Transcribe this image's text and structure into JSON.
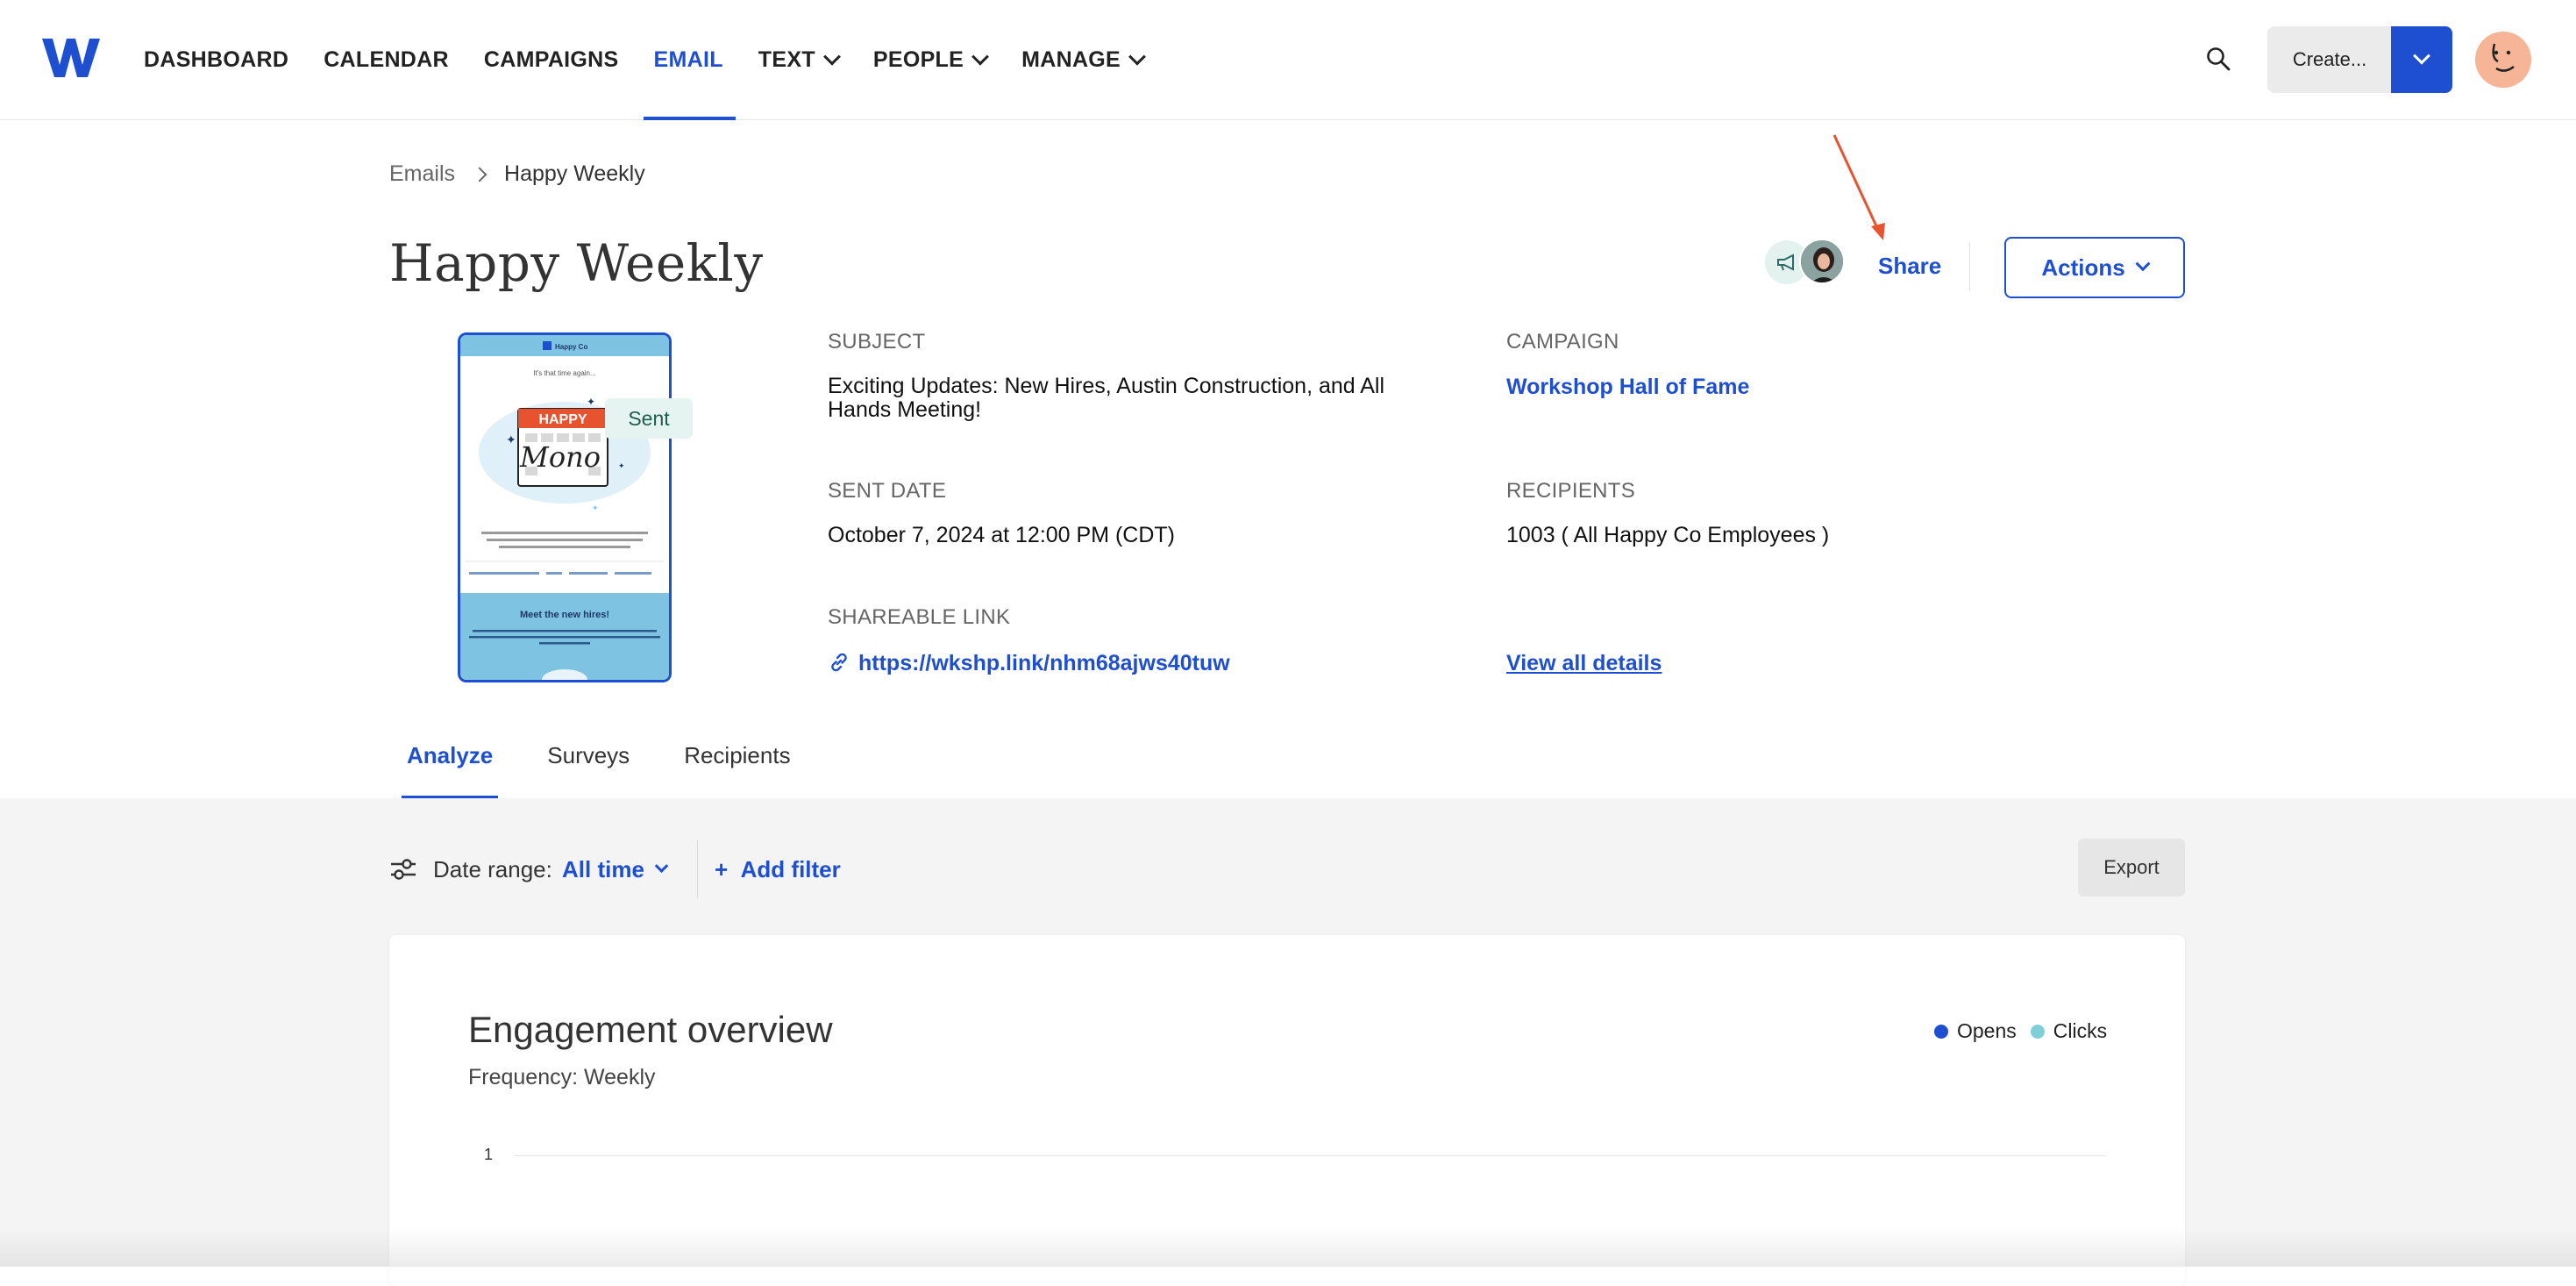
{
  "nav": {
    "items": [
      {
        "label": "DASHBOARD",
        "active": false,
        "has_dropdown": false
      },
      {
        "label": "CALENDAR",
        "active": false,
        "has_dropdown": false
      },
      {
        "label": "CAMPAIGNS",
        "active": false,
        "has_dropdown": false
      },
      {
        "label": "EMAIL",
        "active": true,
        "has_dropdown": false
      },
      {
        "label": "TEXT",
        "active": false,
        "has_dropdown": true
      },
      {
        "label": "PEOPLE",
        "active": false,
        "has_dropdown": true
      },
      {
        "label": "MANAGE",
        "active": false,
        "has_dropdown": true
      }
    ],
    "create_label": "Create..."
  },
  "breadcrumb": {
    "parent": "Emails",
    "current": "Happy Weekly"
  },
  "header": {
    "title": "Happy Weekly",
    "share_label": "Share",
    "actions_label": "Actions"
  },
  "preview": {
    "brand": "Happy Co",
    "intro": "It's that time again...",
    "happy_word": "HAPPY",
    "mono_word": "Mono",
    "sent_badge": "Sent",
    "section_heading": "Meet the new hires!"
  },
  "details": {
    "subject_label": "SUBJECT",
    "subject_value": "Exciting Updates: New Hires, Austin Construction, and All Hands Meeting!",
    "campaign_label": "CAMPAIGN",
    "campaign_value": "Workshop Hall of Fame",
    "sent_date_label": "SENT DATE",
    "sent_date_value": "October 7, 2024 at 12:00 PM (CDT)",
    "recipients_label": "RECIPIENTS",
    "recipients_value": "1003 ( All Happy Co Employees )",
    "shareable_label": "SHAREABLE LINK",
    "shareable_value": "https://wkshp.link/nhm68ajws40tuw",
    "view_all": "View all details"
  },
  "tabs": [
    {
      "label": "Analyze",
      "active": true
    },
    {
      "label": "Surveys",
      "active": false
    },
    {
      "label": "Recipients",
      "active": false
    }
  ],
  "filters": {
    "date_range_label": "Date range:",
    "date_range_value": "All time",
    "add_filter": "Add filter",
    "export": "Export"
  },
  "engagement": {
    "title": "Engagement overview",
    "frequency": "Frequency: Weekly",
    "legend": [
      {
        "name": "Opens",
        "color": "#1f4fd1"
      },
      {
        "name": "Clicks",
        "color": "#7fd0d6"
      }
    ],
    "y_tick": "1"
  },
  "colors": {
    "accent": "#1f4fd1",
    "annotation_arrow": "#e8532f"
  }
}
